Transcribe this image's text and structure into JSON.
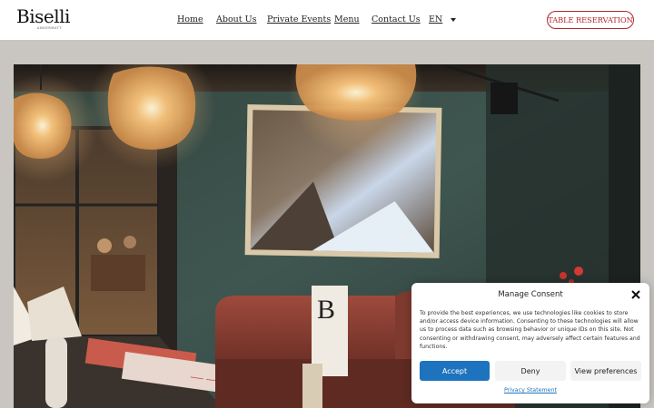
{
  "brand": {
    "name": "Biselli",
    "tagline": "ANDERMATT"
  },
  "nav": {
    "items": [
      {
        "label": "Home"
      },
      {
        "label": "About Us"
      },
      {
        "label": "Private Events"
      },
      {
        "label": "Menu"
      },
      {
        "label": "Contact Us"
      }
    ],
    "language": "EN"
  },
  "header": {
    "reserve_label": "TABLE RESERVATION"
  },
  "hero": {
    "card_letter": "B",
    "image_description": "restaurant interior"
  },
  "consent": {
    "title": "Manage Consent",
    "body": "To provide the best experiences, we use technologies like cookies to store and/or access device information. Consenting to these technologies will allow us to process data such as browsing behavior or unique IDs on this site. Not consenting or withdrawing consent, may adversely affect certain features and functions.",
    "accept_label": "Accept",
    "deny_label": "Deny",
    "preferences_label": "View preferences",
    "link_label": "Privacy Statement"
  },
  "colors": {
    "accent": "#b3272d",
    "consent_button": "#1e73be",
    "page_background": "#c9c6c1"
  },
  "icons": {
    "close": "close-icon",
    "language_dropdown": "chevron-down-icon"
  }
}
